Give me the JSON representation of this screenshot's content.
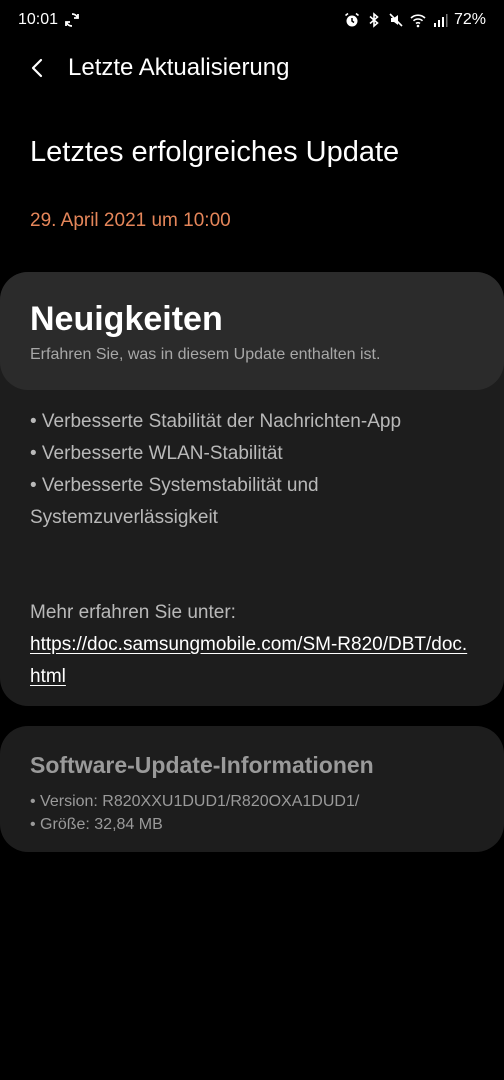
{
  "status_bar": {
    "time": "10:01",
    "battery": "72%",
    "icons": [
      "sync-icon",
      "alarm-icon",
      "bluetooth-icon",
      "mute-icon",
      "wifi-icon",
      "signal-icon"
    ]
  },
  "app_bar": {
    "back_icon": "back-arrow-icon",
    "title": "Letzte Aktualisierung"
  },
  "hero": {
    "title": "Letztes erfolgreiches Update",
    "date": "29. April 2021 um 10:00",
    "date_color": "#e5865a"
  },
  "news": {
    "title": "Neuigkeiten",
    "subtitle": "Erfahren Sie, was in diesem Update enthalten ist.",
    "items": [
      "• Verbesserte Stabilität der Nachrichten-App",
      "• Verbesserte WLAN-Stabilität",
      "• Verbesserte Systemstabilität und Systemzuverlässigkeit"
    ],
    "more_label": "Mehr erfahren Sie unter:",
    "link": "https://doc.samsungmobile.com/SM-R820/DBT/doc.html"
  },
  "software_info": {
    "title": "Software-Update-Informationen",
    "version": "• Version: R820XXU1DUD1/R820OXA1DUD1/",
    "size": "• Größe: 32,84 MB"
  }
}
